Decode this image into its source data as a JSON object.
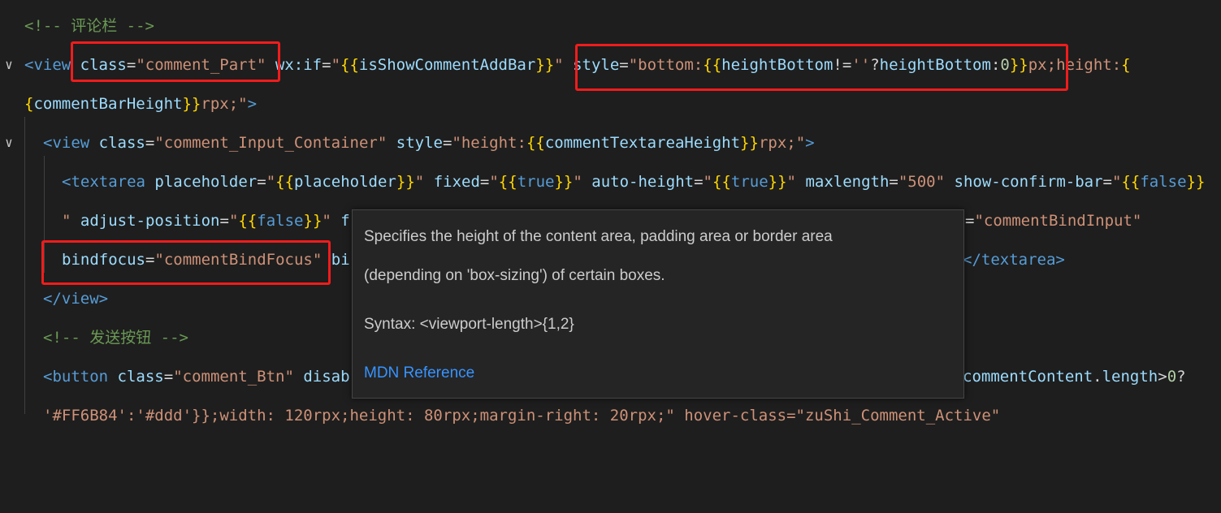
{
  "code_lines": {
    "l1_comment": "<!-- 评论栏 -->",
    "l2": {
      "tag_open": "<view",
      "attr_class": "class",
      "eq": "=",
      "class_val": "\"comment_Part\"",
      "attr_if": "wx:if",
      "if_q1": "\"",
      "if_open": "{{",
      "if_var": "isShowCommentAddBar",
      "if_close": "}}",
      "if_q2": "\"",
      "attr_style": "style",
      "style_q1": "\"",
      "style_prop": "bottom:",
      "style_open": "{{",
      "style_expr1": "heightBottom",
      "style_neq": "!=",
      "style_empty": "''",
      "style_q": "?",
      "style_expr2": "heightBottom",
      "style_colon": ":",
      "style_zero": "0",
      "style_close": "}}",
      "style_unit": "px;",
      "style_prop2": "height:",
      "style_open2": "{"
    },
    "l3": {
      "brace": "{",
      "var": "commentBarHeight",
      "close": "}}",
      "unit": "rpx;",
      "q": "\"",
      "end": ">"
    },
    "l4": {
      "tag_open": "<view",
      "attr_class": "class",
      "class_val": "\"comment_Input_Container\"",
      "attr_style": "style",
      "q1": "\"",
      "prop": "height:",
      "open": "{{",
      "var": "commentTextareaHeight",
      "close": "}}",
      "unit": "rpx;",
      "q2": "\"",
      "end": ">"
    },
    "l5": {
      "tag_open": "<textarea",
      "attr_ph": "placeholder",
      "ph_val_q1": "\"",
      "ph_open": "{{",
      "ph_var": "placeholder",
      "ph_close": "}}",
      "ph_q2": "\"",
      "attr_fixed": "fixed",
      "fixed_q1": "\"",
      "fixed_open": "{{",
      "fixed_val": "true",
      "fixed_close": "}}",
      "fixed_q2": "\"",
      "attr_auto": "auto-height",
      "auto_q1": "\"",
      "auto_open": "{{",
      "auto_val": "true",
      "auto_close": "}}",
      "auto_q2": "\"",
      "attr_max": "maxlength",
      "max_val": "\"500\"",
      "attr_scb": "show-confirm-bar",
      "scb_q1": "\"",
      "scb_open": "{{",
      "scb_val": "false",
      "scb_close": "}}"
    },
    "l6": {
      "q": "\"",
      "attr_adj": "adjust-position",
      "adj_q1": "\"",
      "adj_open": "{{",
      "adj_val": "false",
      "adj_close": "}}",
      "adj_q2": "\"",
      "partial": "f",
      "tail_eq": "=",
      "tail_val": "\"commentBindInput\""
    },
    "l7": {
      "attr": "bindfocus",
      "val": "\"commentBindFocus\"",
      "partial": "bi",
      "tail": "</textarea>"
    },
    "l8": "</view>",
    "l9_comment": "<!-- 发送按钮 -->",
    "l10": {
      "tag_open": "<button",
      "attr_class": "class",
      "class_val": "\"comment_Btn\"",
      "partial": "disab",
      "tail_var": "commentContent",
      "tail_dot": ".",
      "tail_prop": "length",
      "tail_op": ">",
      "tail_num": "0",
      "tail_q": "?"
    },
    "l11": "'#FF6B84':'#ddd'}};width: 120rpx;height: 80rpx;margin-right: 20rpx;\" hover-class=\"zuShi_Comment_Active\""
  },
  "tooltip": {
    "desc_line1": "Specifies the height of the content area, padding area or border area",
    "desc_line2": "(depending on 'box-sizing') of certain boxes.",
    "syntax": "Syntax: <viewport-length>{1,2}",
    "mdn_link": "MDN Reference"
  },
  "fold_icons": [
    "chevron-down-icon",
    "chevron-down-icon"
  ],
  "colors": {
    "background": "#1e1e1e",
    "highlight_box": "#f01c1c",
    "tooltip_bg": "#252526",
    "link": "#3794ff"
  }
}
